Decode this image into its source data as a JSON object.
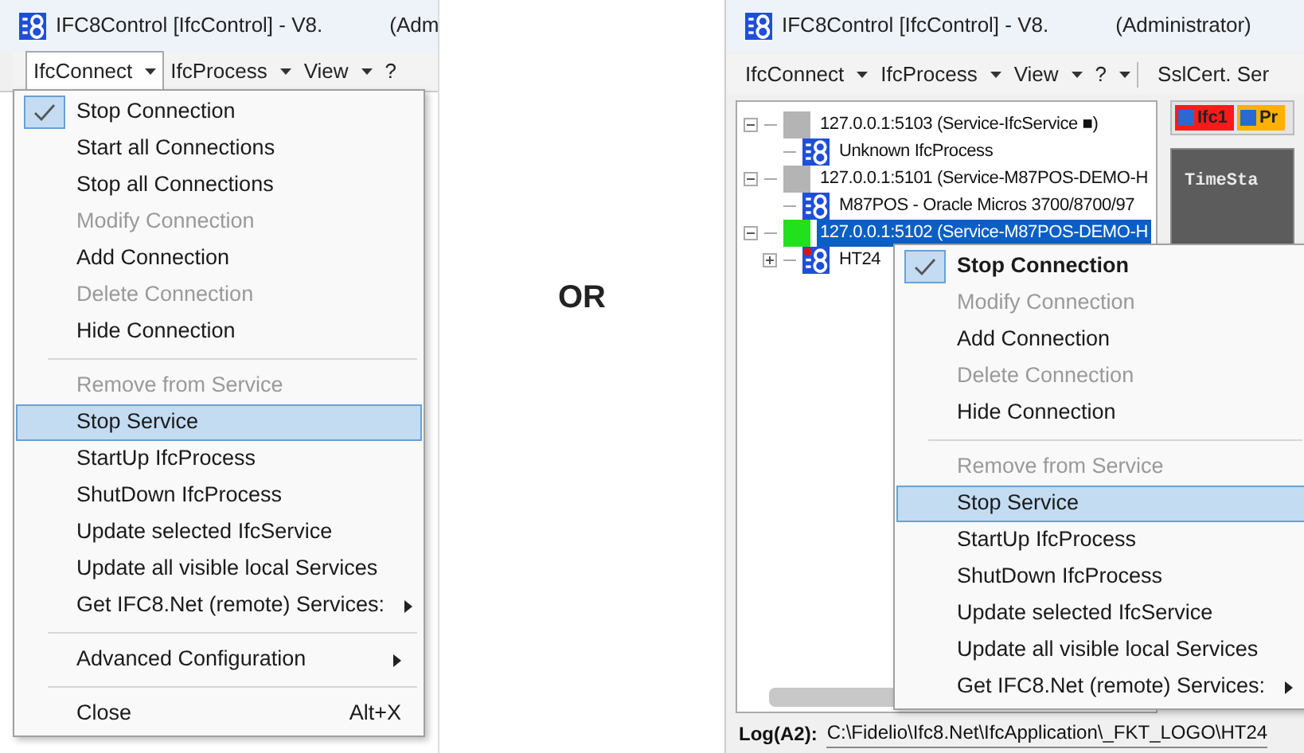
{
  "separator_text": "OR",
  "left_window": {
    "title": "IFC8Control [IfcControl] - V8.",
    "title_suffix": "(Adm",
    "menubar": [
      {
        "label": "IfcConnect",
        "dropdown": true,
        "selected": true
      },
      {
        "label": "IfcProcess",
        "dropdown": true,
        "selected": false
      },
      {
        "label": "View",
        "dropdown": true,
        "selected": false
      },
      {
        "label": "?",
        "dropdown": false,
        "selected": false
      }
    ],
    "menu": [
      {
        "kind": "item",
        "label": "Stop Connection",
        "checked": true,
        "disabled": false,
        "selected": false
      },
      {
        "kind": "item",
        "label": "Start all Connections",
        "checked": false,
        "disabled": false,
        "selected": false
      },
      {
        "kind": "item",
        "label": "Stop all Connections",
        "checked": false,
        "disabled": false,
        "selected": false
      },
      {
        "kind": "item",
        "label": "Modify Connection",
        "checked": false,
        "disabled": true,
        "selected": false
      },
      {
        "kind": "item",
        "label": "Add Connection",
        "checked": false,
        "disabled": false,
        "selected": false
      },
      {
        "kind": "item",
        "label": "Delete Connection",
        "checked": false,
        "disabled": true,
        "selected": false
      },
      {
        "kind": "item",
        "label": "Hide Connection",
        "checked": false,
        "disabled": false,
        "selected": false
      },
      {
        "kind": "separator"
      },
      {
        "kind": "item",
        "label": "Remove from Service",
        "checked": false,
        "disabled": true,
        "selected": false
      },
      {
        "kind": "item",
        "label": "Stop Service",
        "checked": false,
        "disabled": false,
        "selected": true
      },
      {
        "kind": "item",
        "label": "StartUp IfcProcess",
        "checked": false,
        "disabled": false,
        "selected": false
      },
      {
        "kind": "item",
        "label": "ShutDown IfcProcess",
        "checked": false,
        "disabled": false,
        "selected": false
      },
      {
        "kind": "item",
        "label": "Update selected IfcService",
        "checked": false,
        "disabled": false,
        "selected": false
      },
      {
        "kind": "item",
        "label": "Update all visible local Services",
        "checked": false,
        "disabled": false,
        "selected": false
      },
      {
        "kind": "item",
        "label": "Get IFC8.Net (remote) Services:",
        "checked": false,
        "disabled": false,
        "selected": false,
        "submenu": true
      },
      {
        "kind": "separator"
      },
      {
        "kind": "item",
        "label": "Advanced Configuration",
        "checked": false,
        "disabled": false,
        "selected": false,
        "submenu": true
      },
      {
        "kind": "separator"
      },
      {
        "kind": "item",
        "label": "Close",
        "shortcut": "Alt+X",
        "checked": false,
        "disabled": false,
        "selected": false
      }
    ]
  },
  "right_window": {
    "title": "IFC8Control [IfcControl] - V8.",
    "title_suffix": "(Administrator)",
    "menubar": [
      {
        "label": "IfcConnect",
        "dropdown": true,
        "selected": false
      },
      {
        "label": "IfcProcess",
        "dropdown": true,
        "selected": false
      },
      {
        "label": "View",
        "dropdown": true,
        "selected": false
      },
      {
        "label": "?",
        "dropdown": true,
        "selected": false
      },
      {
        "label": "SslCert. Ser",
        "dropdown": false,
        "selected": false
      }
    ],
    "tree": [
      {
        "label": "127.0.0.1:5103 (Service-IfcService ■)",
        "color": "#b4b4b4",
        "expanded": true,
        "selected": false,
        "children": [
          {
            "label": "Unknown IfcProcess",
            "alert": false
          }
        ]
      },
      {
        "label": "127.0.0.1:5101 (Service-M87POS-DEMO-H",
        "color": "#b4b4b4",
        "expanded": true,
        "selected": false,
        "children": [
          {
            "label": "M87POS - Oracle Micros 3700/8700/97",
            "alert": false
          }
        ]
      },
      {
        "label": "127.0.0.1:5102 (Service-M87POS-DEMO-H",
        "color": "#22e01c",
        "expanded": true,
        "selected": true,
        "children": [
          {
            "label": "HT24",
            "alert": true,
            "expanded": false
          }
        ]
      }
    ],
    "filters": [
      {
        "label": "Ifc1",
        "checked": true,
        "color": "#ff1a1a"
      },
      {
        "label": "Pr",
        "checked": true,
        "color": "#ffb000"
      }
    ],
    "log_view": {
      "column_1": "TimeSta"
    },
    "context_menu": [
      {
        "kind": "item",
        "label": "Stop Connection",
        "checked": true,
        "default": true,
        "disabled": false,
        "selected": false
      },
      {
        "kind": "item",
        "label": "Modify Connection",
        "checked": false,
        "disabled": true,
        "selected": false
      },
      {
        "kind": "item",
        "label": "Add Connection",
        "checked": false,
        "disabled": false,
        "selected": false
      },
      {
        "kind": "item",
        "label": "Delete Connection",
        "checked": false,
        "disabled": true,
        "selected": false
      },
      {
        "kind": "item",
        "label": "Hide Connection",
        "checked": false,
        "disabled": false,
        "selected": false
      },
      {
        "kind": "separator"
      },
      {
        "kind": "item",
        "label": "Remove from Service",
        "checked": false,
        "disabled": true,
        "selected": false
      },
      {
        "kind": "item",
        "label": "Stop Service",
        "checked": false,
        "disabled": false,
        "selected": true
      },
      {
        "kind": "item",
        "label": "StartUp IfcProcess",
        "checked": false,
        "disabled": false,
        "selected": false
      },
      {
        "kind": "item",
        "label": "ShutDown IfcProcess",
        "checked": false,
        "disabled": false,
        "selected": false
      },
      {
        "kind": "item",
        "label": "Update selected IfcService",
        "checked": false,
        "disabled": false,
        "selected": false
      },
      {
        "kind": "item",
        "label": "Update all visible local Services",
        "checked": false,
        "disabled": false,
        "selected": false
      },
      {
        "kind": "item",
        "label": "Get IFC8.Net (remote) Services:",
        "checked": false,
        "disabled": false,
        "selected": false,
        "submenu": true
      }
    ],
    "log_bar": {
      "label": "Log(A2):",
      "path": "C:\\Fidelio\\Ifc8.Net\\IfcApplication\\_FKT_LOGO\\HT24"
    }
  }
}
